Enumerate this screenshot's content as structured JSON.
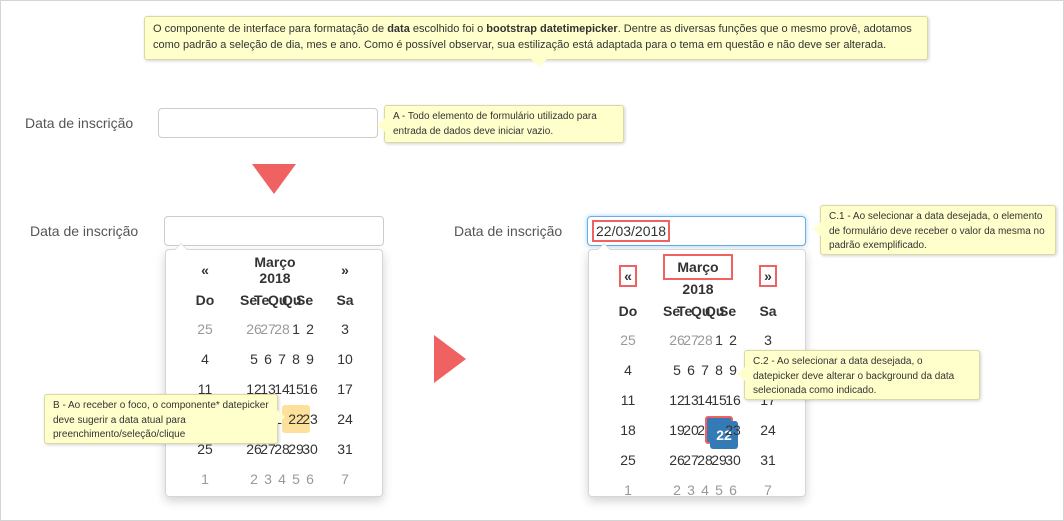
{
  "notes": {
    "top": {
      "pre": "O componente de interface para formatação de ",
      "bold1": "data",
      "mid": " escolhido foi o ",
      "bold2": "bootstrap datetimepicker",
      "post": ". Dentre as diversas funções que o mesmo provê, adotamos como padrão a seleção de dia, mes e ano. Como é possível observar, sua estilização está adaptada para o tema em questão e não deve ser alterada."
    },
    "a": "A - Todo elemento de formulário utilizado para entrada de dados deve iniciar vazio.",
    "b": "B - Ao receber o foco, o componente* datepicker deve sugerir a data atual para preenchimento/seleção/clique",
    "c1": "C.1 - Ao selecionar a data desejada, o elemento de formulário deve receber o valor da mesma no padrão exemplificado.",
    "c2": "C.2 - Ao selecionar a data desejada, o datepicker deve alterar o background da data selecionada como indicado."
  },
  "field": {
    "label": "Data de inscrição",
    "empty_value": "",
    "selected_value": "22/03/2018"
  },
  "datepicker": {
    "prev": "«",
    "next": "»",
    "month_label": "Março 2018",
    "weekdays": [
      "Do",
      "Se",
      "Te",
      "Qu",
      "Qu",
      "Se",
      "Sa"
    ],
    "weeks": [
      [
        {
          "d": "25",
          "c": "old"
        },
        {
          "d": "26",
          "c": "old"
        },
        {
          "d": "27",
          "c": "old"
        },
        {
          "d": "28",
          "c": "old"
        },
        {
          "d": "1"
        },
        {
          "d": "2"
        },
        {
          "d": "3"
        }
      ],
      [
        {
          "d": "4"
        },
        {
          "d": "5"
        },
        {
          "d": "6"
        },
        {
          "d": "7"
        },
        {
          "d": "8"
        },
        {
          "d": "9"
        },
        {
          "d": "10"
        }
      ],
      [
        {
          "d": "11"
        },
        {
          "d": "12"
        },
        {
          "d": "13"
        },
        {
          "d": "14"
        },
        {
          "d": "15"
        },
        {
          "d": "16"
        },
        {
          "d": "17"
        }
      ],
      [
        {
          "d": "18"
        },
        {
          "d": "19"
        },
        {
          "d": "20"
        },
        {
          "d": "21"
        },
        {
          "d": "22",
          "c": "target"
        },
        {
          "d": "23"
        },
        {
          "d": "24"
        }
      ],
      [
        {
          "d": "25"
        },
        {
          "d": "26"
        },
        {
          "d": "27"
        },
        {
          "d": "28"
        },
        {
          "d": "29"
        },
        {
          "d": "30"
        },
        {
          "d": "31"
        }
      ],
      [
        {
          "d": "1",
          "c": "new"
        },
        {
          "d": "2",
          "c": "new"
        },
        {
          "d": "3",
          "c": "new"
        },
        {
          "d": "4",
          "c": "new"
        },
        {
          "d": "5",
          "c": "new"
        },
        {
          "d": "6",
          "c": "new"
        },
        {
          "d": "7",
          "c": "new"
        }
      ]
    ]
  },
  "colors": {
    "highlight_red": "#f06262",
    "today_bg": "#fde19a",
    "active_bg": "#337ab7",
    "note_bg": "#ffffcc"
  }
}
